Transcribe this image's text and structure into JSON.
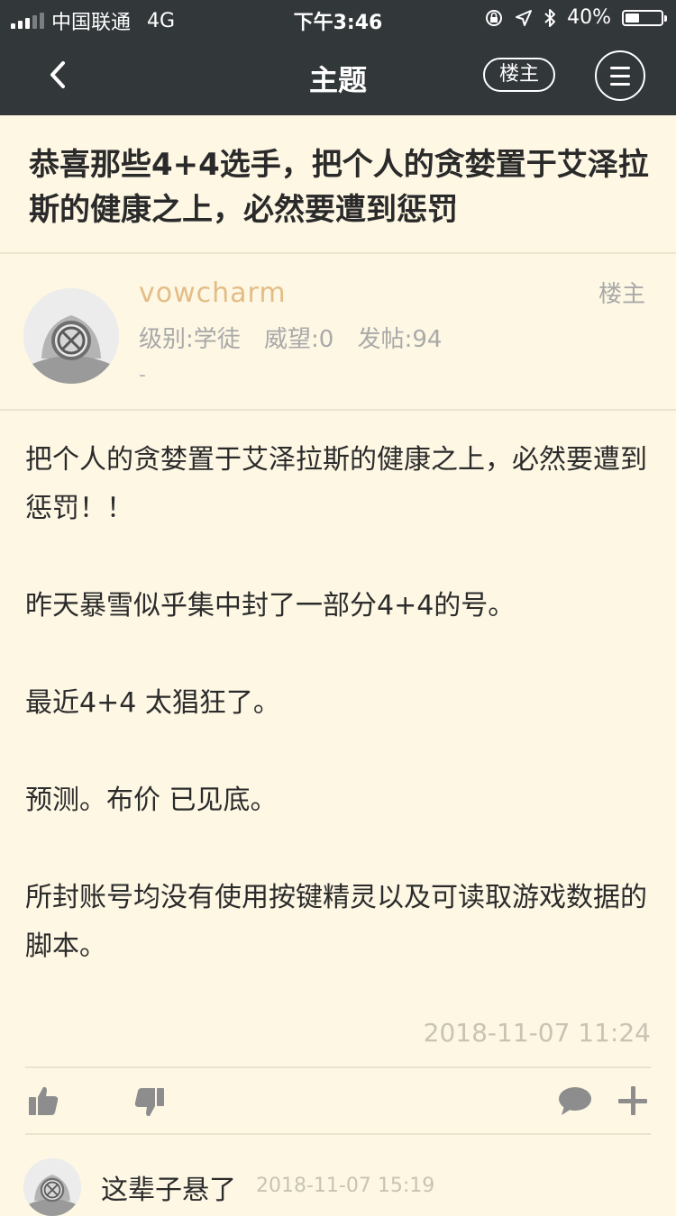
{
  "status_bar": {
    "carrier": "中国联通",
    "network": "4G",
    "time": "下午3:46",
    "battery_percent_text": "40%",
    "battery_level": 0.4
  },
  "nav": {
    "title": "主题",
    "op_button": "楼主"
  },
  "post": {
    "title": "恭喜那些4+4选手，把个人的贪婪置于艾泽拉斯的健康之上，必然要遭到惩罚",
    "author": {
      "name": "vowcharm",
      "level": "级别:学徒",
      "prestige": "威望:0",
      "posts": "发帖:94",
      "signature": "-"
    },
    "floor_label": "楼主",
    "paragraphs": [
      "把个人的贪婪置于艾泽拉斯的健康之上，必然要遭到惩罚！！",
      "昨天暴雪似乎集中封了一部分4+4的号。",
      "最近4+4 太猖狂了。",
      "预测。布价 已见底。",
      "所封账号均没有使用按键精灵以及可读取游戏数据的脚本。"
    ],
    "time": "2018-11-07 11:24"
  },
  "actions": {
    "like_icon": "thumbs-up-icon",
    "dislike_icon": "thumbs-down-icon",
    "comment_icon": "comment-icon",
    "more_icon": "plus-icon"
  },
  "reply": {
    "text": "这辈子悬了",
    "time": "2018-11-07 15:19"
  },
  "colors": {
    "bar": "#32373a",
    "background": "#fdf7e4",
    "author_name": "#e3bd86",
    "muted": "#a9a9a9"
  }
}
